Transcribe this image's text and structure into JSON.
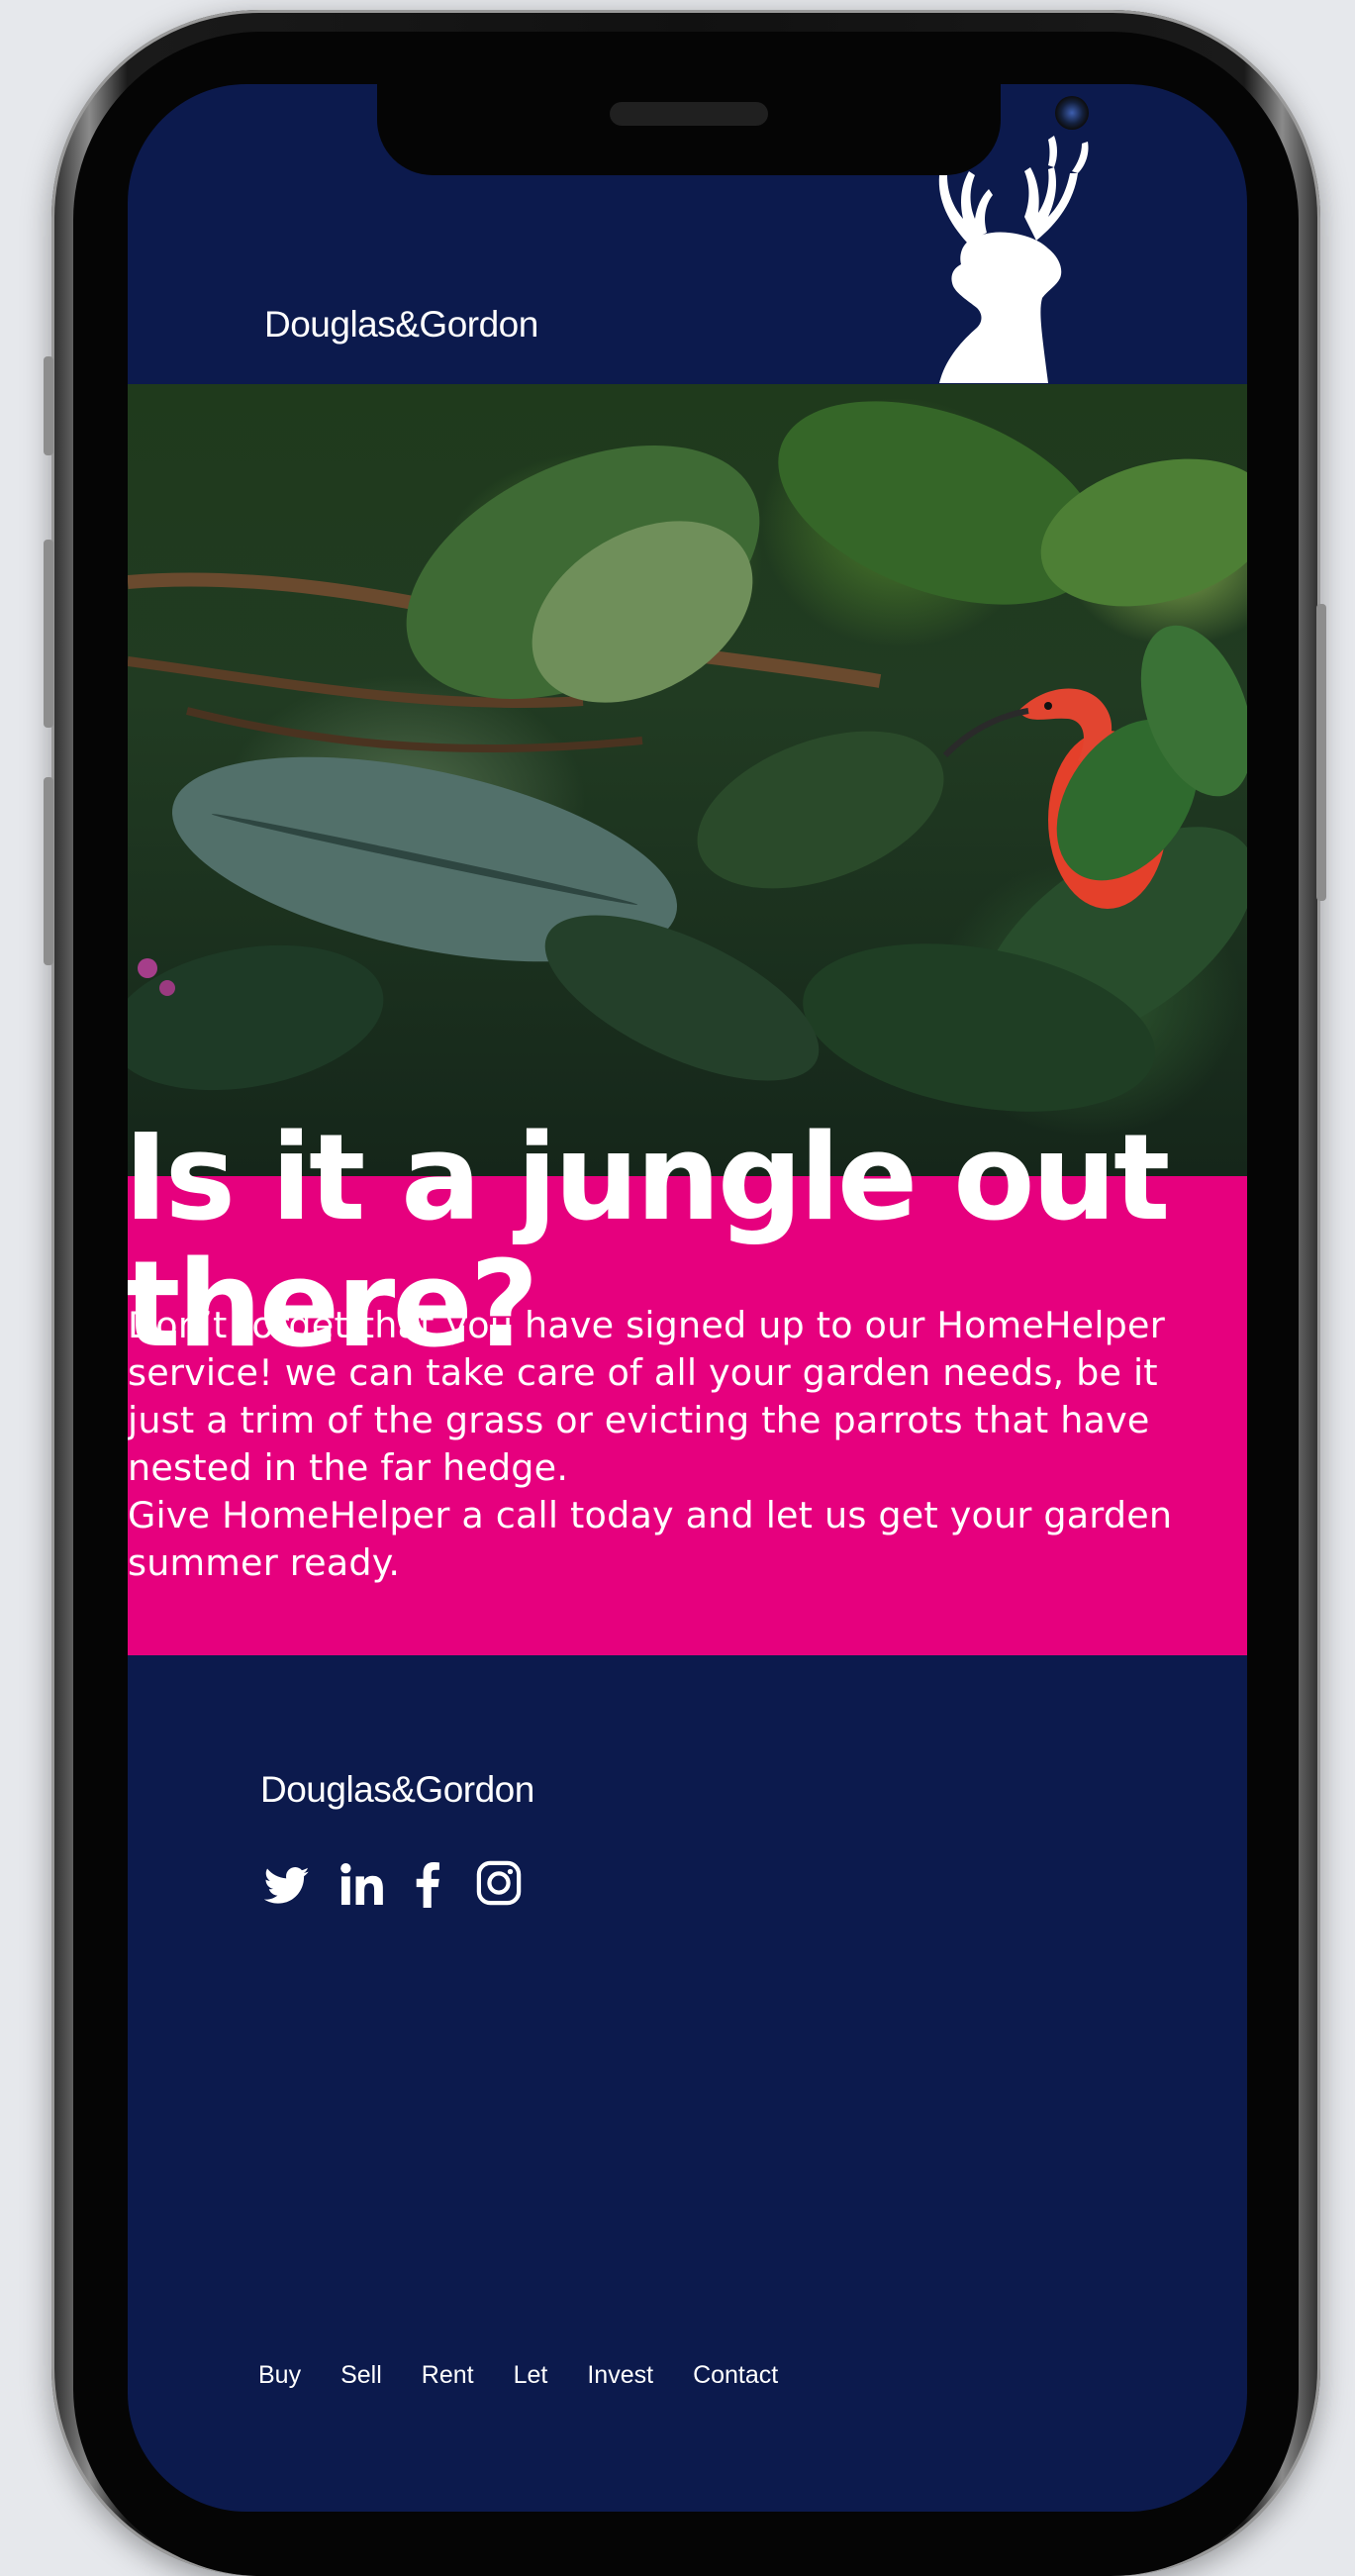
{
  "header": {
    "brand": "Douglas&Gordon",
    "logo_icon": "stag-head-icon"
  },
  "hero": {
    "image": "jungle-scarlet-ibis-photo",
    "headline_line1": "Is it a jungle out",
    "headline_line2": "there?"
  },
  "message": {
    "paragraph1_line1": "Don’t forget that you have signed up to our HomeHelper",
    "paragraph1_line2": "service! we can take care of all your garden needs, be it",
    "paragraph1_line3": "just a trim of the grass or evicting the parrots that have",
    "paragraph1_line4": "nested in the far hedge.",
    "paragraph2_line1": "Give HomeHelper a call today and let us get your garden",
    "paragraph2_line2": "summer ready."
  },
  "footer": {
    "brand": "Douglas&Gordon",
    "social": [
      "twitter-icon",
      "linkedin-icon",
      "facebook-icon",
      "instagram-icon"
    ],
    "nav": [
      "Buy",
      "Sell",
      "Rent",
      "Let",
      "Invest",
      "Contact"
    ]
  },
  "colors": {
    "navy": "#0c1a4d",
    "pink": "#e6007e",
    "white": "#ffffff"
  }
}
